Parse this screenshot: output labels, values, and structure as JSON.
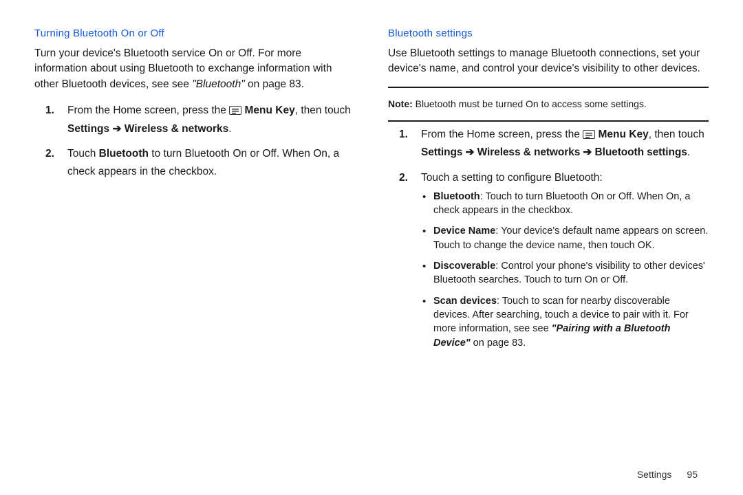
{
  "left": {
    "heading": "Turning Bluetooth On or Off",
    "intro_pre": "Turn your device's Bluetooth service On or Off. For more information about using Bluetooth to exchange information with other Bluetooth devices, see see ",
    "intro_ref": "\"Bluetooth\"",
    "intro_post": " on page 83.",
    "step1_pre": "From the Home screen, press the ",
    "step1_menukey": "Menu Key",
    "step1_mid": ", then touch ",
    "step1_path": "Settings ➔ Wireless & networks",
    "step1_end": ".",
    "step2_pre": "Touch ",
    "step2_bold": "Bluetooth",
    "step2_post": " to turn Bluetooth On or Off. When On, a check appears in the checkbox."
  },
  "right": {
    "heading": "Bluetooth settings",
    "intro": "Use Bluetooth settings to manage Bluetooth connections, set your device's name, and control your device's visibility to other devices.",
    "note_label": "Note:",
    "note_text": " Bluetooth must be turned On to access some settings.",
    "step1_pre": "From the Home screen, press the ",
    "step1_menukey": "Menu Key",
    "step1_mid": ", then touch ",
    "step1_path": "Settings ➔ Wireless & networks ➔ Bluetooth settings",
    "step1_end": ".",
    "step2": "Touch a setting to configure Bluetooth:",
    "bullets": {
      "b1_label": "Bluetooth",
      "b1_text": ": Touch to turn Bluetooth On or Off. When On, a check appears in the checkbox.",
      "b2_label": "Device Name",
      "b2_text": ": Your device's default name appears on screen. Touch to change the device name, then touch OK.",
      "b3_label": "Discoverable",
      "b3_text": ": Control your phone's visibility to other devices' Bluetooth searches. Touch to turn On or Off.",
      "b4_label": "Scan devices",
      "b4_text_pre": ": Touch to scan for nearby discoverable devices. After searching, touch a device to pair with it. For more information, see see ",
      "b4_ref": "\"Pairing with a Bluetooth Device\"",
      "b4_text_post": " on page 83."
    }
  },
  "footer": {
    "chapter": "Settings",
    "page": "95"
  }
}
